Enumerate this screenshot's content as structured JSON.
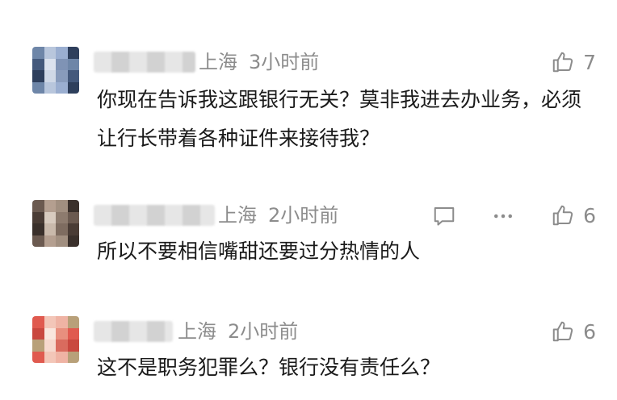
{
  "comments": [
    {
      "location": "上海",
      "time": "3小时前",
      "text": "你现在告诉我这跟银行无关？莫非我进去办业务，必须让行长带着各种证件来接待我？",
      "likes": "7",
      "avatar_palette": [
        "#6e86a8",
        "#9aaed0",
        "#cfd8e6",
        "#44597c",
        "#7f93b5",
        "#b8c6dc",
        "#2e3f5c",
        "#889bbb",
        "#dbe2ee"
      ]
    },
    {
      "location": "上海",
      "time": "2小时前",
      "text": "所以不要相信嘴甜还要过分热情的人",
      "likes": "6",
      "avatar_palette": [
        "#6b5a50",
        "#a18f80",
        "#c9b9ab",
        "#4a3c35",
        "#8d7b6e",
        "#b49f90",
        "#3a302b",
        "#7e6c60",
        "#d8cbbf"
      ]
    },
    {
      "location": "上海",
      "time": "2小时前",
      "text": "这不是职务犯罪么？银行没有责任么？",
      "likes": "6",
      "avatar_palette": [
        "#e05a4f",
        "#efb3a4",
        "#f6d8cd",
        "#c9483f",
        "#e88f7e",
        "#f3c6b8",
        "#b8a079",
        "#d96b5e",
        "#f9e6dd"
      ]
    }
  ],
  "icons": {
    "like": "thumbs-up-icon",
    "reply": "comment-icon",
    "more": "more-icon"
  },
  "colors": {
    "meta": "#8c8c8c",
    "text": "#1a1a1a"
  }
}
